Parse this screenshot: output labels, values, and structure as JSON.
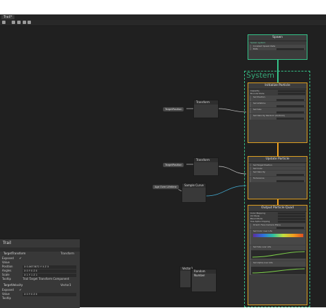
{
  "window": {
    "tab_label": "Trail*"
  },
  "system": {
    "frame_label": "System",
    "spawn": {
      "title": "Spawn",
      "subtitle": "Spawn system",
      "rows": [
        "Constant Spawn Rate",
        "Rate"
      ]
    },
    "init": {
      "title": "Initialize Particle",
      "badge": "Mesh",
      "rows": [
        "Capacity",
        "Bounds Mode",
        "Set Position",
        "Set Lifetime",
        "Set Size",
        "Set Velocity Random (Uniform)"
      ]
    },
    "update": {
      "title": "Update Particle",
      "badge": "Mesh",
      "rows": [
        "Set Target Position",
        "Set Color",
        "Set Velocity",
        "Turbulence"
      ]
    },
    "output": {
      "title": "Output Particle Quad",
      "badge": "Mesh",
      "rows": [
        "Color Mapping",
        "UV Mode",
        "Blend Mode",
        "Use Alpha Clipping",
        "Orient: Face Camera Plane",
        "Set Color over Life",
        "Set Size over Life",
        "Set Alpha over Life"
      ]
    }
  },
  "graph": {
    "pill_1": "TargetPosition",
    "pill_2": "TargetPosition",
    "pill_3": "Age Over Lifetime",
    "node_transform_1": "Transform",
    "node_transform_2": "Transform",
    "node_sample": "Sample Curve",
    "node_small_1": "Vector3",
    "node_small_2": "Random Number"
  },
  "inspector": {
    "title": "Trail",
    "section": "TargetTransform",
    "section_type": "Transform",
    "rows": [
      {
        "label": "Exposed",
        "value": "✔"
      },
      {
        "label": "Value",
        "value": ""
      },
      {
        "label": "Position",
        "value": "X 0.0673872   Y 0   Z 0"
      },
      {
        "label": "Angles",
        "value": "X 0   Y 0   Z 0"
      },
      {
        "label": "Scale",
        "value": "X 1   Y 1   Z 1"
      },
      {
        "label": "Tooltip",
        "value": "Trail Target Transform Component"
      }
    ],
    "section2": "TargetVelocity",
    "section2_type": "Vector3",
    "rows2": [
      {
        "label": "Exposed",
        "value": "✔"
      },
      {
        "label": "Value",
        "value": "X 0   Y 0   Z 0"
      },
      {
        "label": "Tooltip",
        "value": ""
      }
    ]
  }
}
